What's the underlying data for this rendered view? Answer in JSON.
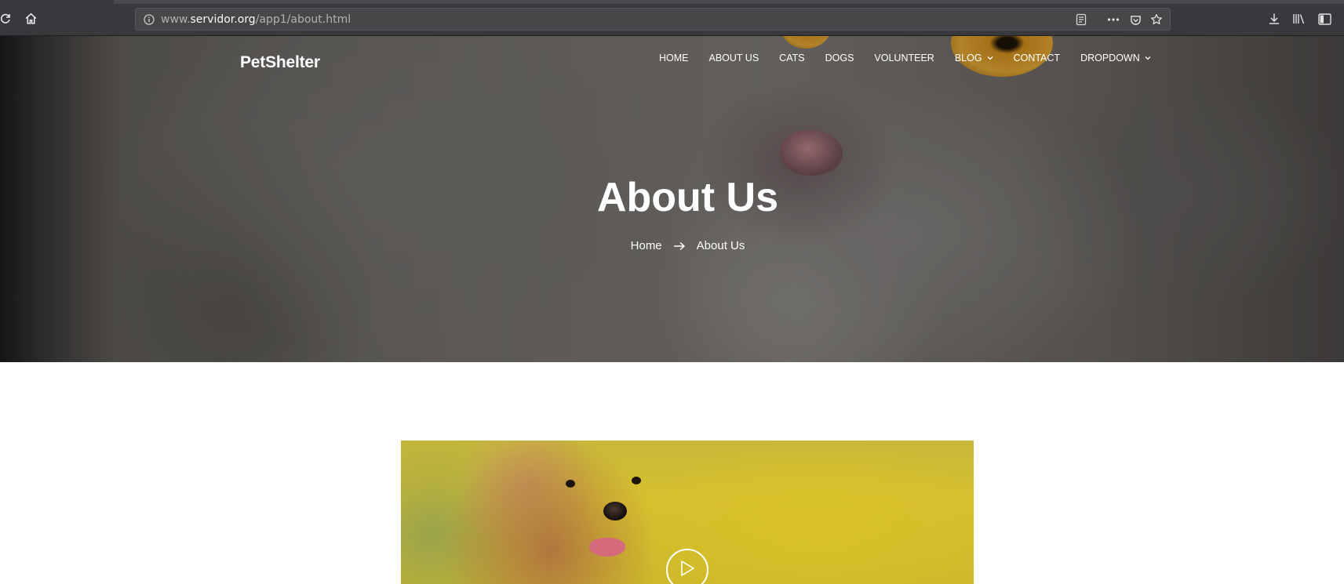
{
  "browser": {
    "url_prefix": "www.",
    "url_host": "servidor.org",
    "url_path": "/app1/about.html",
    "icons": [
      "reload-icon",
      "home-icon",
      "info-icon",
      "reader-view-icon",
      "page-actions-icon",
      "pocket-icon",
      "bookmark-star-icon",
      "downloads-icon",
      "library-icon",
      "sidebar-icon"
    ]
  },
  "site": {
    "logo": "PetShelter",
    "nav": [
      {
        "label": "HOME"
      },
      {
        "label": "ABOUT US"
      },
      {
        "label": "CATS"
      },
      {
        "label": "DOGS"
      },
      {
        "label": "VOLUNTEER"
      },
      {
        "label": "BLOG",
        "has_dropdown": true
      },
      {
        "label": "CONTACT"
      },
      {
        "label": "DROPDOWN",
        "has_dropdown": true
      }
    ]
  },
  "hero": {
    "title": "About Us",
    "breadcrumb": {
      "home": "Home",
      "current": "About Us"
    }
  },
  "video": {
    "play_icon": "play-icon"
  },
  "colors": {
    "browser_chrome": "#38383d",
    "url_box": "#474749",
    "hero_text": "#ffffff",
    "page_background": "#ffffff"
  }
}
